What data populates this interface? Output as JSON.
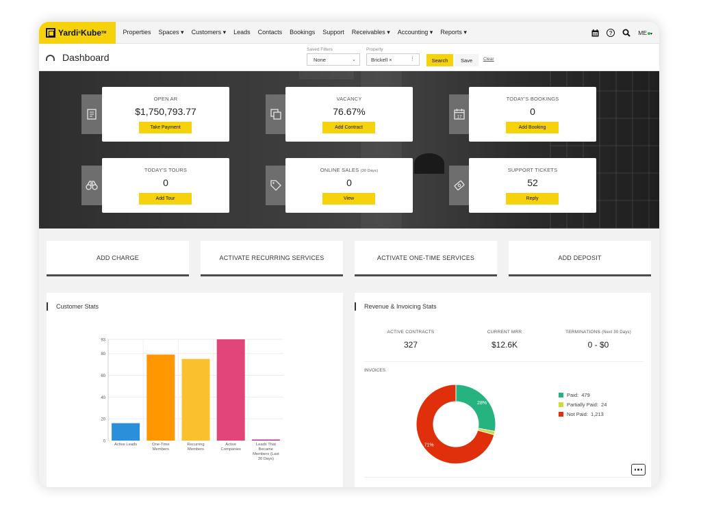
{
  "brand": {
    "name": "Yardi",
    "product": "Kube",
    "tm": "TM"
  },
  "nav": {
    "items": [
      "Properties",
      "Spaces ▾",
      "Customers ▾",
      "Leads",
      "Contacts",
      "Bookings",
      "Support",
      "Receivables ▾",
      "Accounting ▾",
      "Reports ▾"
    ],
    "user": "ME"
  },
  "header": {
    "title": "Dashboard",
    "saved_filters_label": "Saved Filters",
    "saved_filters_value": "None",
    "property_label": "Property",
    "property_value": "Brickell ×",
    "search_label": "Search",
    "save_label": "Save",
    "clear_label": "Clear"
  },
  "stats": [
    {
      "label": "OPEN AR",
      "value": "$1,750,793.77",
      "action": "Take Payment",
      "icon": "receipt-icon"
    },
    {
      "label": "VACANCY",
      "value": "76.67%",
      "action": "Add Contract",
      "icon": "copy-icon"
    },
    {
      "label": "TODAY'S BOOKINGS",
      "value": "0",
      "action": "Add Booking",
      "icon": "calendar-icon",
      "icon_text": "17"
    },
    {
      "label": "TODAY'S TOURS",
      "value": "0",
      "action": "Add Tour",
      "icon": "binoculars-icon"
    },
    {
      "label": "ONLINE SALES",
      "label_note": "(30 Days)",
      "value": "0",
      "action": "View",
      "icon": "tag-icon"
    },
    {
      "label": "SUPPORT TICKETS",
      "value": "52",
      "action": "Reply",
      "icon": "ticket-icon"
    }
  ],
  "quick_actions": [
    "ADD CHARGE",
    "ACTIVATE RECURRING SERVICES",
    "ACTIVATE ONE-TIME SERVICES",
    "ADD DEPOSIT"
  ],
  "customer_stats": {
    "title": "Customer Stats"
  },
  "revenue": {
    "title": "Revenue & Invoicing Stats",
    "active_contracts_label": "ACTIVE CONTRACTS",
    "active_contracts_value": "327",
    "mrr_label": "CURRENT MRR",
    "mrr_value": "$12.6K",
    "terminations_label": "TERMINATIONS",
    "terminations_note": "(Next 30 Days)",
    "terminations_value": "0 - $0",
    "invoices_label": "INVOICES"
  },
  "colors": {
    "accent": "#f5d20c",
    "active_leads": "#2b90d9",
    "one_time": "#ff9800",
    "recurring": "#fbc02d",
    "companies": "#e2457a",
    "leads_converted": "#b03ba0",
    "paid": "#26b380",
    "partially_paid": "#cddc39",
    "not_paid": "#e0300b"
  },
  "chart_data": [
    {
      "type": "bar",
      "categories": [
        "Active Leads",
        "One-Time Members",
        "Recurring Members",
        "Active Companies",
        "Leads That Became Members (Last 30 Days)"
      ],
      "category_lines": [
        [
          "Active Leads"
        ],
        [
          "One-Time",
          "Members"
        ],
        [
          "Recurring",
          "Members"
        ],
        [
          "Active",
          "Companies"
        ],
        [
          "Leads That",
          "Became",
          "Members (Last",
          "30 Days)"
        ]
      ],
      "values": [
        16,
        79,
        75,
        93,
        1
      ],
      "ylim": [
        0,
        93
      ],
      "yticks": [
        0,
        20,
        40,
        60,
        80,
        93
      ],
      "grid": true
    },
    {
      "type": "pie",
      "categories": [
        "Paid",
        "Partially Paid",
        "Not Paid"
      ],
      "values": [
        479,
        24,
        1213
      ],
      "slice_labels": [
        "28%",
        "",
        "71%"
      ],
      "legend_labels": [
        "Paid:  479",
        "Partially Paid:  24",
        "Not Paid:  1,213"
      ],
      "legend": "right"
    }
  ]
}
